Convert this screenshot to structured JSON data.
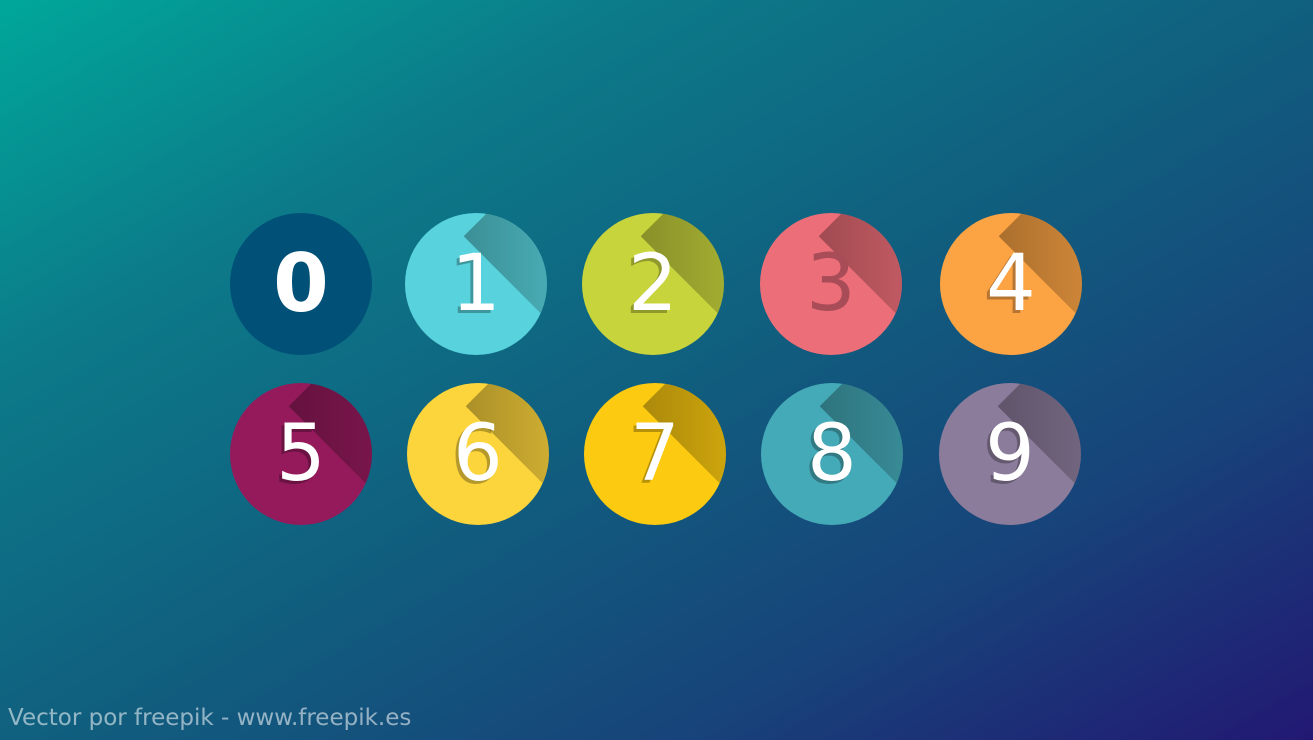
{
  "badges": [
    {
      "label": "0",
      "color": "#005078"
    },
    {
      "label": "1",
      "color": "#58d2dc"
    },
    {
      "label": "2",
      "color": "#c8d43c"
    },
    {
      "label": "3",
      "color": "#ec6e78"
    },
    {
      "label": "4",
      "color": "#fca444"
    },
    {
      "label": "5",
      "color": "#941a5c"
    },
    {
      "label": "6",
      "color": "#fcd43c"
    },
    {
      "label": "7",
      "color": "#fcca10"
    },
    {
      "label": "8",
      "color": "#44aab8"
    },
    {
      "label": "9",
      "color": "#8c7c9c"
    }
  ],
  "credit": "Vector por freepik - www.freepik.es"
}
